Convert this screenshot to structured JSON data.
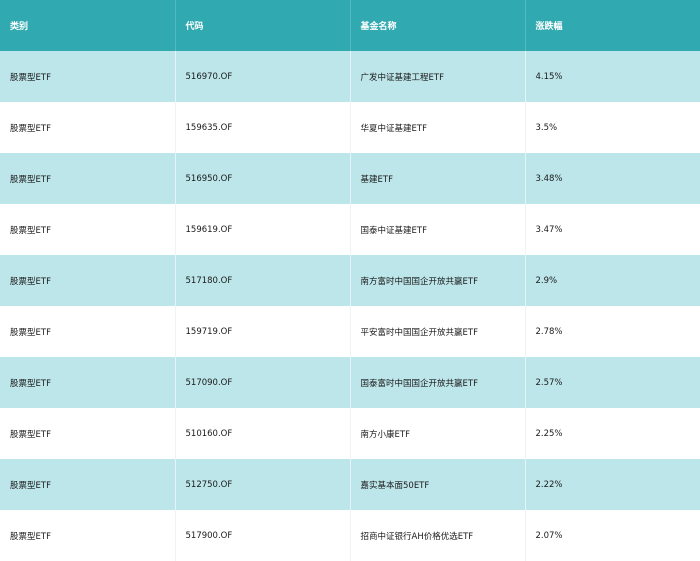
{
  "colors": {
    "header_bg": "#30a9b0",
    "header_text": "#ffffff",
    "row_alt_bg": "#bde6ea",
    "row_bg": "#ffffff"
  },
  "table": {
    "headers": [
      "类别",
      "代码",
      "基金名称",
      "涨跌幅"
    ],
    "rows": [
      [
        "股票型ETF",
        "516970.OF",
        "广发中证基建工程ETF",
        "4.15%"
      ],
      [
        "股票型ETF",
        "159635.OF",
        "华夏中证基建ETF",
        "3.5%"
      ],
      [
        "股票型ETF",
        "516950.OF",
        "基建ETF",
        "3.48%"
      ],
      [
        "股票型ETF",
        "159619.OF",
        "国泰中证基建ETF",
        "3.47%"
      ],
      [
        "股票型ETF",
        "517180.OF",
        "南方富时中国国企开放共赢ETF",
        "2.9%"
      ],
      [
        "股票型ETF",
        "159719.OF",
        "平安富时中国国企开放共赢ETF",
        "2.78%"
      ],
      [
        "股票型ETF",
        "517090.OF",
        "国泰富时中国国企开放共赢ETF",
        "2.57%"
      ],
      [
        "股票型ETF",
        "510160.OF",
        "南方小康ETF",
        "2.25%"
      ],
      [
        "股票型ETF",
        "512750.OF",
        "嘉实基本面50ETF",
        "2.22%"
      ],
      [
        "股票型ETF",
        "517900.OF",
        "招商中证银行AH价格优选ETF",
        "2.07%"
      ]
    ]
  }
}
